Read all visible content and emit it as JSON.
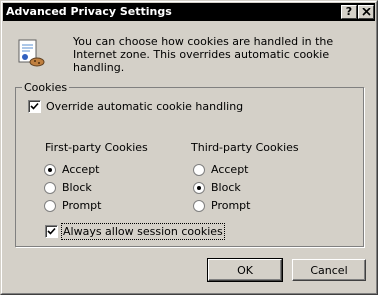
{
  "window": {
    "title": "Advanced Privacy Settings",
    "help_button": "?",
    "close_button": "X"
  },
  "description": "You can choose how cookies are handled in the Internet zone.  This overrides automatic cookie handling.",
  "info_icon": "privacy-document-icon",
  "cookies_group": {
    "label": "Cookies",
    "override": {
      "label": "Override automatic cookie handling",
      "checked": true
    },
    "first_party": {
      "header": "First-party Cookies",
      "options": [
        "Accept",
        "Block",
        "Prompt"
      ],
      "selected": "Accept"
    },
    "third_party": {
      "header": "Third-party Cookies",
      "options": [
        "Accept",
        "Block",
        "Prompt"
      ],
      "selected": "Block"
    },
    "session": {
      "label": "Always allow session cookies",
      "checked": true
    }
  },
  "buttons": {
    "ok": "OK",
    "cancel": "Cancel"
  },
  "colors": {
    "title_bar": "#000000",
    "face": "#d4d0c8"
  }
}
